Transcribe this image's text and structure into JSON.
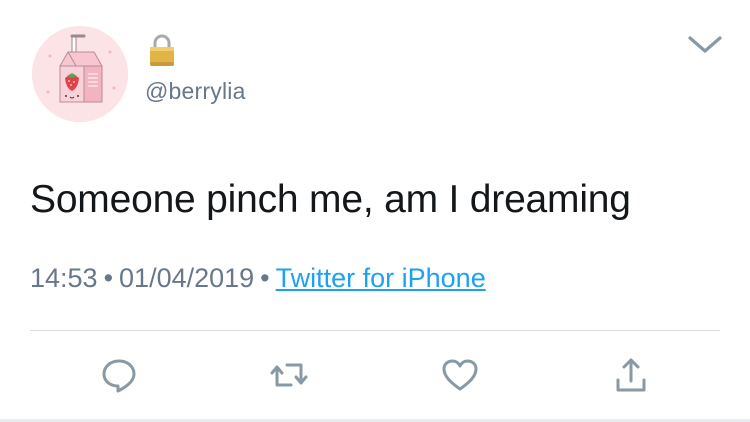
{
  "user": {
    "handle": "@berrylia",
    "avatar_icon": "strawberry-milk-carton-icon",
    "protected_icon": "lock-icon"
  },
  "tweet": {
    "text": "Someone pinch me, am I dreaming",
    "time": "14:53",
    "date": "01/04/2019",
    "separator": "•",
    "source": "Twitter for iPhone"
  },
  "menu": {
    "icon": "chevron-down-icon"
  },
  "actions": [
    {
      "name": "reply",
      "icon": "reply-icon"
    },
    {
      "name": "retweet",
      "icon": "retweet-icon"
    },
    {
      "name": "like",
      "icon": "heart-icon"
    },
    {
      "name": "share",
      "icon": "share-icon"
    }
  ],
  "colors": {
    "link": "#1da1f2",
    "muted": "#68788a",
    "text": "#14171a",
    "icon": "#8899a6"
  }
}
